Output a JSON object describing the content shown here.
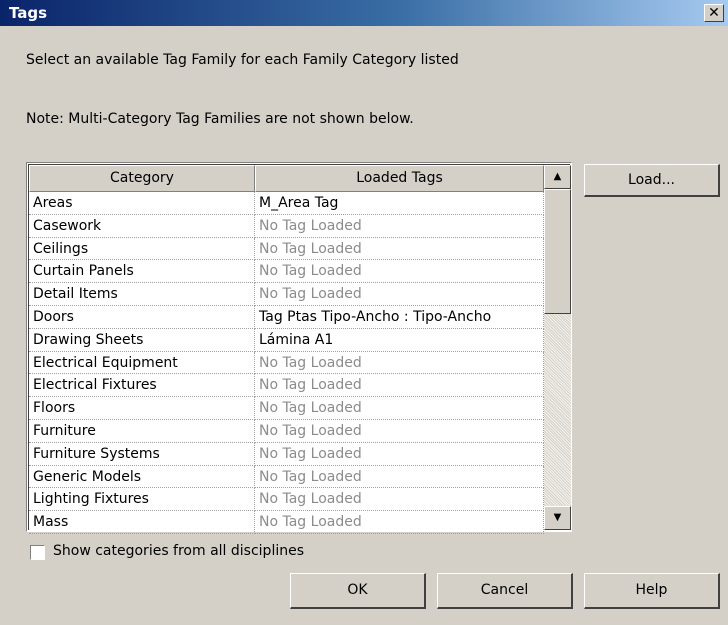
{
  "window": {
    "title": "Tags",
    "close_glyph": "✕"
  },
  "instructions": "Select an available Tag Family for each Family Category listed",
  "note": "Note: Multi-Category Tag Families are not shown below.",
  "table": {
    "columns": [
      "Category",
      "Loaded Tags"
    ],
    "rows": [
      {
        "category": "Areas",
        "tag": "M_Area Tag",
        "loaded": true
      },
      {
        "category": "Casework",
        "tag": "No Tag Loaded",
        "loaded": false
      },
      {
        "category": "Ceilings",
        "tag": "No Tag Loaded",
        "loaded": false
      },
      {
        "category": "Curtain Panels",
        "tag": "No Tag Loaded",
        "loaded": false
      },
      {
        "category": "Detail Items",
        "tag": "No Tag Loaded",
        "loaded": false
      },
      {
        "category": "Doors",
        "tag": "Tag Ptas Tipo-Ancho : Tipo-Ancho",
        "loaded": true
      },
      {
        "category": "Drawing Sheets",
        "tag": "Lámina A1",
        "loaded": true
      },
      {
        "category": "Electrical Equipment",
        "tag": "No Tag Loaded",
        "loaded": false
      },
      {
        "category": "Electrical Fixtures",
        "tag": "No Tag Loaded",
        "loaded": false
      },
      {
        "category": "Floors",
        "tag": "No Tag Loaded",
        "loaded": false
      },
      {
        "category": "Furniture",
        "tag": "No Tag Loaded",
        "loaded": false
      },
      {
        "category": "Furniture Systems",
        "tag": "No Tag Loaded",
        "loaded": false
      },
      {
        "category": "Generic Models",
        "tag": "No Tag Loaded",
        "loaded": false
      },
      {
        "category": "Lighting Fixtures",
        "tag": "No Tag Loaded",
        "loaded": false
      },
      {
        "category": "Mass",
        "tag": "No Tag Loaded",
        "loaded": false
      }
    ]
  },
  "scrollbar": {
    "up_icon": "triangle-up-icon",
    "down_icon": "triangle-down-icon"
  },
  "buttons": {
    "load": "Load...",
    "ok": "OK",
    "cancel": "Cancel",
    "help": "Help"
  },
  "checkbox": {
    "label": "Show categories from all disciplines",
    "checked": false
  },
  "colors": {
    "dialog_bg": "#d4d0c8",
    "title_start": "#0a246a",
    "title_end": "#a6caf0",
    "disabled_text": "#8c8c8c"
  }
}
